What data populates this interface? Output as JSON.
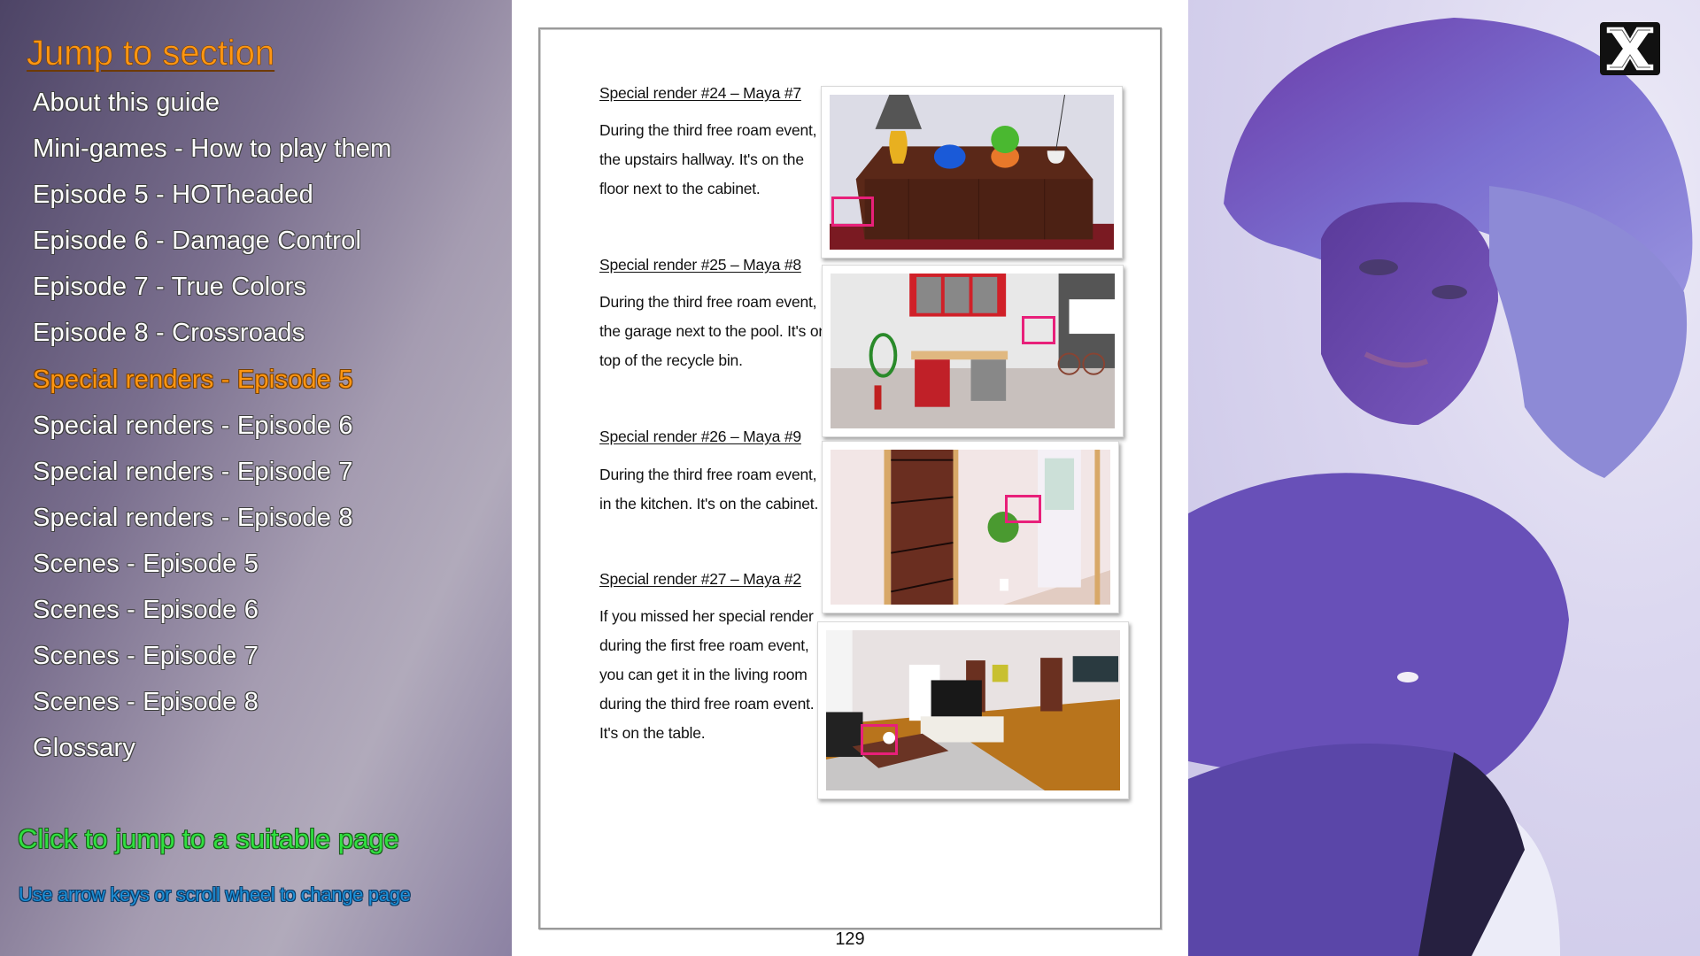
{
  "nav": {
    "heading": "Jump to section",
    "items": [
      {
        "label": "About this guide",
        "active": false
      },
      {
        "label": "Mini-games - How to play them",
        "active": false
      },
      {
        "label": "Episode 5 - HOTheaded",
        "active": false
      },
      {
        "label": "Episode 6 - Damage Control",
        "active": false
      },
      {
        "label": "Episode 7 - True Colors",
        "active": false
      },
      {
        "label": "Episode 8 - Crossroads",
        "active": false
      },
      {
        "label": "Special renders - Episode 5",
        "active": true
      },
      {
        "label": "Special renders - Episode 6",
        "active": false
      },
      {
        "label": "Special renders - Episode 7",
        "active": false
      },
      {
        "label": "Special renders - Episode 8",
        "active": false
      },
      {
        "label": "Scenes - Episode 5",
        "active": false
      },
      {
        "label": "Scenes - Episode 6",
        "active": false
      },
      {
        "label": "Scenes - Episode 7",
        "active": false
      },
      {
        "label": "Scenes - Episode 8",
        "active": false
      },
      {
        "label": "Glossary",
        "active": false
      }
    ],
    "hint_primary": "Click to jump to a suitable page",
    "hint_secondary": "Use arrow keys or scroll wheel to change page"
  },
  "page": {
    "number": "129",
    "entries": [
      {
        "title": "Special render #24 – Maya #7",
        "lines": [
          "During the third free roam event, in",
          "the upstairs hallway.  It's on the",
          "floor next to the cabinet."
        ],
        "image": "hallway-cabinet-screenshot"
      },
      {
        "title": "Special render #25 – Maya #8",
        "lines": [
          "During the third free roam event, in",
          "the garage next to the pool.  It's on",
          "top of the recycle bin."
        ],
        "image": "garage-screenshot"
      },
      {
        "title": "Special render #26 – Maya #9",
        "lines": [
          "During the third free roam event,",
          "in the kitchen.  It's on the cabinet."
        ],
        "image": "kitchen-screenshot"
      },
      {
        "title": "Special render #27 – Maya #2",
        "lines": [
          "If you missed her special render",
          "during the first free roam event,",
          "you can get it in the living room",
          "during the third free roam event.",
          "It's on the table."
        ],
        "image": "living-room-screenshot"
      }
    ]
  },
  "close_button": {
    "icon": "close-x-icon",
    "label": "X"
  },
  "colors": {
    "active_nav": "#ff9612",
    "hint_primary": "#30e040",
    "hint_secondary": "#1d8fd6",
    "highlight_box": "#e8207a"
  }
}
